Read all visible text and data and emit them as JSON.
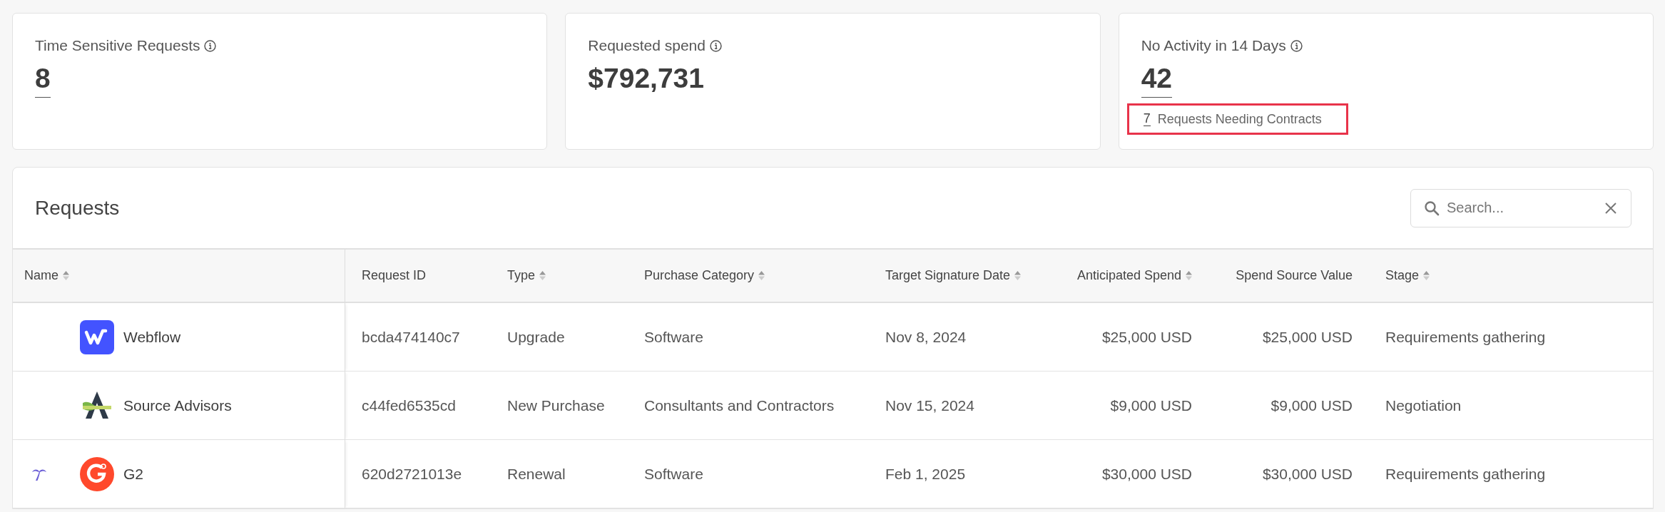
{
  "stats": [
    {
      "label": "Time Sensitive Requests",
      "value": "8",
      "value_link": true
    },
    {
      "label": "Requested spend",
      "value": "$792,731",
      "value_link": false
    },
    {
      "label": "No Activity in 14 Days",
      "value": "42",
      "value_link": true,
      "sub": {
        "count": "7",
        "label": "Requests Needing Contracts",
        "highlighted": true
      }
    }
  ],
  "requests": {
    "title": "Requests",
    "search": {
      "placeholder": "Search..."
    },
    "columns": [
      {
        "label": "Name",
        "sortable": true
      },
      {
        "label": "Request ID",
        "sortable": false
      },
      {
        "label": "Type",
        "sortable": true
      },
      {
        "label": "Purchase Category",
        "sortable": true
      },
      {
        "label": "Target Signature Date",
        "sortable": true
      },
      {
        "label": "Anticipated Spend",
        "sortable": true
      },
      {
        "label": "Spend Source Value",
        "sortable": false
      },
      {
        "label": "Stage",
        "sortable": true
      }
    ],
    "rows": [
      {
        "flagged": false,
        "kind": "webflow",
        "cells": [
          "Webflow",
          "bcda474140c7",
          "Upgrade",
          "Software",
          "Nov 8, 2024",
          "$25,000 USD",
          "$25,000 USD",
          "Requirements gathering"
        ]
      },
      {
        "flagged": false,
        "kind": "source-advisors",
        "cells": [
          "Source Advisors",
          "c44fed6535cd",
          "New Purchase",
          "Consultants and Contractors",
          "Nov 15, 2024",
          "$9,000 USD",
          "$9,000 USD",
          "Negotiation"
        ]
      },
      {
        "flagged": true,
        "kind": "g2",
        "cells": [
          "G2",
          "620d2721013e",
          "Renewal",
          "Software",
          "Feb 1, 2025",
          "$30,000 USD",
          "$30,000 USD",
          "Requirements gathering"
        ]
      }
    ]
  }
}
